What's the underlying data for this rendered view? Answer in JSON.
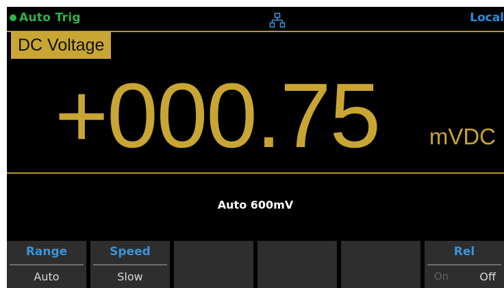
{
  "status": {
    "trigger": "Auto  Trig",
    "remote": "Local",
    "network_icon": "lan-network-icon",
    "trigger_color": "#2fb34a",
    "remote_color": "#2a8fe0"
  },
  "measurement": {
    "mode": "DC Voltage",
    "value": "+000.75",
    "unit": "mVDC",
    "range": "Auto  600mV",
    "accent_color": "#c9a533"
  },
  "softkeys": [
    {
      "label": "Range",
      "value": "Auto"
    },
    {
      "label": "Speed",
      "value": "Slow"
    },
    {
      "label": "",
      "value": ""
    },
    {
      "label": "",
      "value": ""
    },
    {
      "label": "",
      "value": ""
    },
    {
      "label": "Rel",
      "on": "On",
      "off": "Off",
      "selected": "Off"
    }
  ]
}
